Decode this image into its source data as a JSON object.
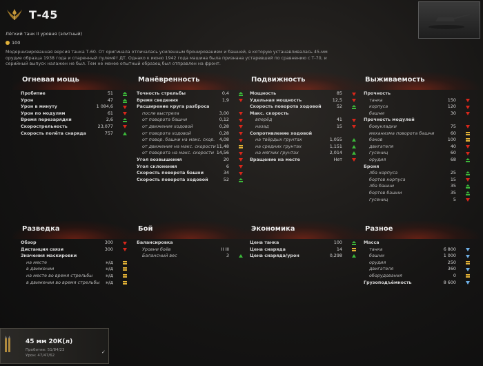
{
  "header": {
    "title": "Т-45",
    "subtitle": "Лёгкий танк II уровня (элитный)",
    "price": "100",
    "description": "Модернизированная версия танка Т-60. От оригинала отличалась усиленным бронированием и башней, в которую устанавливалась 45-мм орудие образца 1938 года и спаренный пулемёт ДТ. Однако к июню 1942 года машина была признана устаревшей по сравнению с Т-70, и серийный выпуск налажен не был. Тем не менее опытный образец был отправлен на фронт."
  },
  "sections": {
    "firepower": {
      "title": "Огневая мощь",
      "rows": [
        {
          "label": "Пробитие",
          "value": "51",
          "ind": "uplines"
        },
        {
          "label": "Урон",
          "value": "47",
          "ind": "uplines"
        },
        {
          "label": "Урон в минуту",
          "value": "1 084,6",
          "ind": "down"
        },
        {
          "label": "Урон по модулям",
          "value": "61",
          "ind": "down"
        },
        {
          "label": "Время перезарядки",
          "value": "2,6",
          "ind": "uplines"
        },
        {
          "label": "Скорострельность",
          "value": "23,077",
          "ind": "down"
        },
        {
          "label": "Скорость полёта снаряда",
          "value": "757",
          "ind": "up"
        }
      ]
    },
    "maneuver": {
      "title": "Манёвренность",
      "rows": [
        {
          "label": "Точность стрельбы",
          "value": "0,4",
          "ind": "uplines"
        },
        {
          "label": "Время сведения",
          "value": "1,9",
          "ind": "down"
        },
        {
          "label": "Расширение круга разброса",
          "value": "",
          "ind": ""
        },
        {
          "label": "после выстрела",
          "value": "3,00",
          "ind": "down",
          "sub": true
        },
        {
          "label": "от поворота башни",
          "value": "0,12",
          "ind": "down",
          "sub": true
        },
        {
          "label": "от движения ходовой",
          "value": "0,28",
          "ind": "down",
          "sub": true
        },
        {
          "label": "от поворота ходовой",
          "value": "0,28",
          "ind": "down",
          "sub": true
        },
        {
          "label": "от повор. башни на макс. скор.",
          "value": "4,08",
          "ind": "down",
          "sub": true
        },
        {
          "label": "от движения на макс. скорости",
          "value": "11,48",
          "ind": "eq",
          "sub": true
        },
        {
          "label": "от поворота на макс. скорости",
          "value": "14,56",
          "ind": "down",
          "sub": true
        },
        {
          "label": "Угол возвышения",
          "value": "20",
          "ind": "down"
        },
        {
          "label": "Угол склонения",
          "value": "6",
          "ind": "down"
        },
        {
          "label": "Скорость поворота башни",
          "value": "34",
          "ind": "down"
        },
        {
          "label": "Скорость поворота ходовой",
          "value": "52",
          "ind": "uplines"
        }
      ]
    },
    "mobility": {
      "title": "Подвижность",
      "rows": [
        {
          "label": "Мощность",
          "value": "85",
          "ind": "down"
        },
        {
          "label": "Удельная мощность",
          "value": "12,5",
          "ind": "down"
        },
        {
          "label": "Скорость поворота ходовой",
          "value": "52",
          "ind": "uplines"
        },
        {
          "label": "Макс. скорость",
          "value": "",
          "ind": ""
        },
        {
          "label": "вперёд",
          "value": "41",
          "ind": "down",
          "sub": true
        },
        {
          "label": "назад",
          "value": "15",
          "ind": "down",
          "sub": true
        },
        {
          "label": "Сопротивление ходовой",
          "value": "",
          "ind": ""
        },
        {
          "label": "на твёрдых грунтах",
          "value": "1,055",
          "ind": "up",
          "sub": true
        },
        {
          "label": "на средних грунтах",
          "value": "1,151",
          "ind": "up",
          "sub": true
        },
        {
          "label": "на мягких грунтах",
          "value": "2,014",
          "ind": "up",
          "sub": true
        },
        {
          "label": "Вращение на месте",
          "value": "Нет",
          "ind": "down"
        }
      ]
    },
    "survivability": {
      "title": "Выживаемость",
      "rows": [
        {
          "label": "Прочность",
          "value": "",
          "ind": ""
        },
        {
          "label": "танка",
          "value": "150",
          "ind": "down",
          "sub": true
        },
        {
          "label": "корпуса",
          "value": "120",
          "ind": "down",
          "sub": true
        },
        {
          "label": "башни",
          "value": "30",
          "ind": "down",
          "sub": true
        },
        {
          "label": "Прочность модулей",
          "value": "",
          "ind": ""
        },
        {
          "label": "боеукладки",
          "value": "75",
          "ind": "down",
          "sub": true
        },
        {
          "label": "механизма поворота башни",
          "value": "60",
          "ind": "eq",
          "sub": true
        },
        {
          "label": "баков",
          "value": "100",
          "ind": "eq",
          "sub": true
        },
        {
          "label": "двигателя",
          "value": "40",
          "ind": "down",
          "sub": true
        },
        {
          "label": "гусениц",
          "value": "60",
          "ind": "down",
          "sub": true
        },
        {
          "label": "орудия",
          "value": "68",
          "ind": "uplines",
          "sub": true
        },
        {
          "label": "Броня",
          "value": "",
          "ind": ""
        },
        {
          "label": "лба корпуса",
          "value": "25",
          "ind": "uplines",
          "sub": true
        },
        {
          "label": "бортов корпуса",
          "value": "15",
          "ind": "down",
          "sub": true
        },
        {
          "label": "лба башни",
          "value": "35",
          "ind": "uplines",
          "sub": true
        },
        {
          "label": "бортов башни",
          "value": "35",
          "ind": "uplines",
          "sub": true
        },
        {
          "label": "гусениц",
          "value": "5",
          "ind": "down",
          "sub": true
        }
      ]
    },
    "recon": {
      "title": "Разведка",
      "rows": [
        {
          "label": "Обзор",
          "value": "300",
          "ind": "down"
        },
        {
          "label": "Дистанция связи",
          "value": "300",
          "ind": "down"
        },
        {
          "label": "Значения маскировки",
          "value": "",
          "ind": ""
        },
        {
          "label": "на месте",
          "value": "н/д",
          "ind": "eq",
          "sub": true
        },
        {
          "label": "в движении",
          "value": "н/д",
          "ind": "eq",
          "sub": true
        },
        {
          "label": "на месте во время стрельбы",
          "value": "н/д",
          "ind": "eq",
          "sub": true
        },
        {
          "label": "в движении во время стрельбы",
          "value": "н/д",
          "ind": "eq",
          "sub": true
        }
      ]
    },
    "battle": {
      "title": "Бой",
      "rows": [
        {
          "label": "Балансировка",
          "value": "",
          "ind": ""
        },
        {
          "label": "Уровни боёв",
          "value": "II III",
          "ind": "",
          "sub": true
        },
        {
          "label": "Балансный вес",
          "value": "3",
          "ind": "up",
          "sub": true
        }
      ]
    },
    "economy": {
      "title": "Экономика",
      "rows": [
        {
          "label": "Цена танка",
          "value": "100",
          "ind": "uplines"
        },
        {
          "label": "Цена снаряда",
          "value": "14",
          "ind": "eq"
        },
        {
          "label": "Цена снаряда/урон",
          "value": "0,298",
          "ind": "up"
        }
      ]
    },
    "misc": {
      "title": "Разное",
      "rows": [
        {
          "label": "Масса",
          "value": "",
          "ind": ""
        },
        {
          "label": "танка",
          "value": "6 800",
          "ind": "down-blue",
          "sub": true
        },
        {
          "label": "башни",
          "value": "1 000",
          "ind": "down-blue",
          "sub": true
        },
        {
          "label": "орудия",
          "value": "250",
          "ind": "eq",
          "sub": true
        },
        {
          "label": "двигателя",
          "value": "360",
          "ind": "down-blue",
          "sub": true
        },
        {
          "label": "оборудования",
          "value": "0",
          "ind": "eq",
          "sub": true
        },
        {
          "label": "Грузоподъёмность",
          "value": "8 600",
          "ind": "down-blue"
        }
      ]
    }
  },
  "ammo": {
    "name": "45 мм 20К(л)",
    "penetration": "Пробитие: 51/84/23",
    "damage": "Урон: 47/47/62",
    "check": "✓"
  },
  "icons": {
    "emblem": "tank-tier-emblem-icon",
    "coin": "silver-coin-icon",
    "ammo": "ammo-shell-icon"
  }
}
